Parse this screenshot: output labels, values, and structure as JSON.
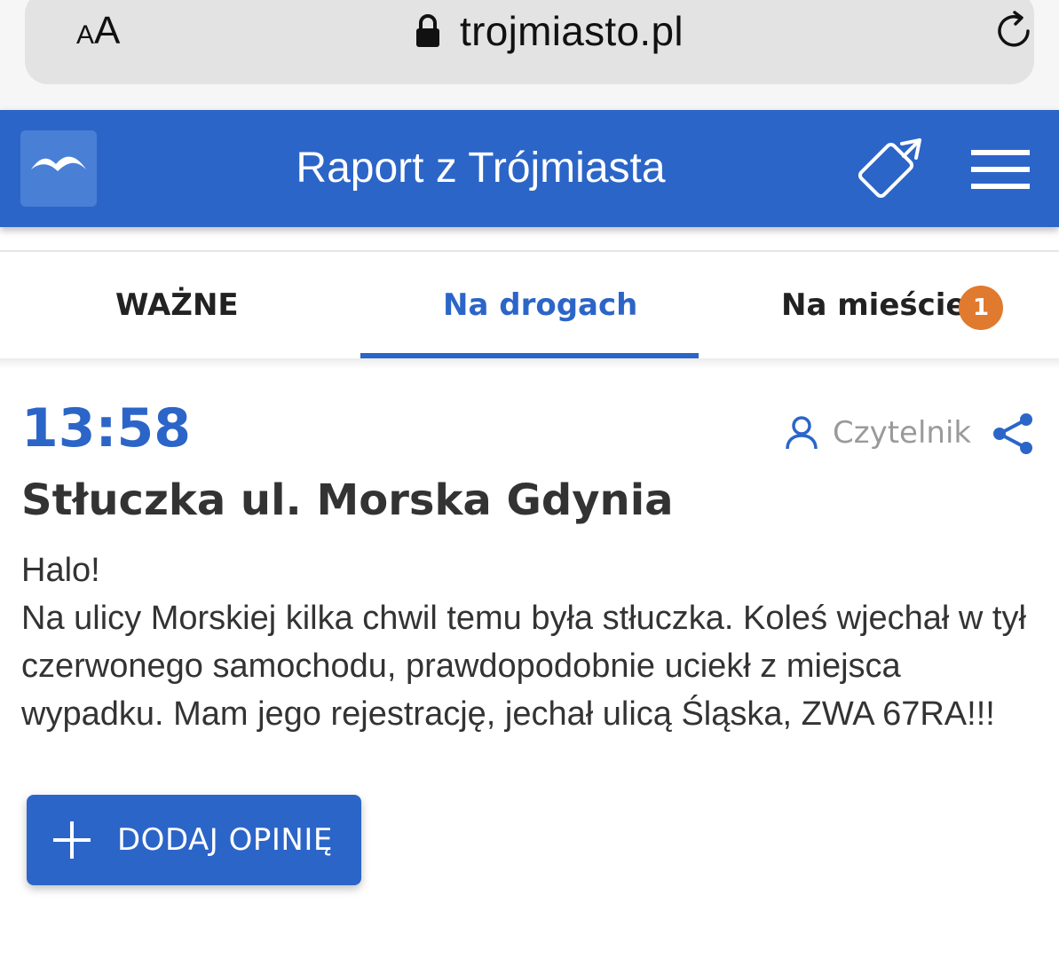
{
  "browser": {
    "aa_small": "A",
    "aa_big": "A",
    "url": "trojmiasto.pl",
    "icons": [
      "lock-icon",
      "reload-icon"
    ]
  },
  "header": {
    "title": "Raport z Trójmiasta",
    "brand_color": "#2c65c8",
    "icons": [
      "seagull-logo-icon",
      "rotate-phone-icon",
      "hamburger-menu-icon"
    ]
  },
  "tabs": {
    "items": [
      {
        "label": "WAŻNE"
      },
      {
        "label": "Na drogach",
        "active": true
      },
      {
        "label": "Na mieście",
        "badge": "1"
      }
    ],
    "badge_color": "#e07a2f"
  },
  "post": {
    "time": "13:58",
    "author": "Czytelnik",
    "title": "Stłuczka ul. Morska Gdynia",
    "greeting": "Halo!",
    "body": "Na ulicy Morskiej kilka chwil temu była stłuczka. Koleś wjechał w tył czerwonego samochodu, prawdopodobnie uciekł z miejsca wypadku. Mam jego rejestrację, jechał ulicą Śląska, ZWA 67RA!!!"
  },
  "actions": {
    "add_opinion_label": "DODAJ OPINIĘ"
  }
}
